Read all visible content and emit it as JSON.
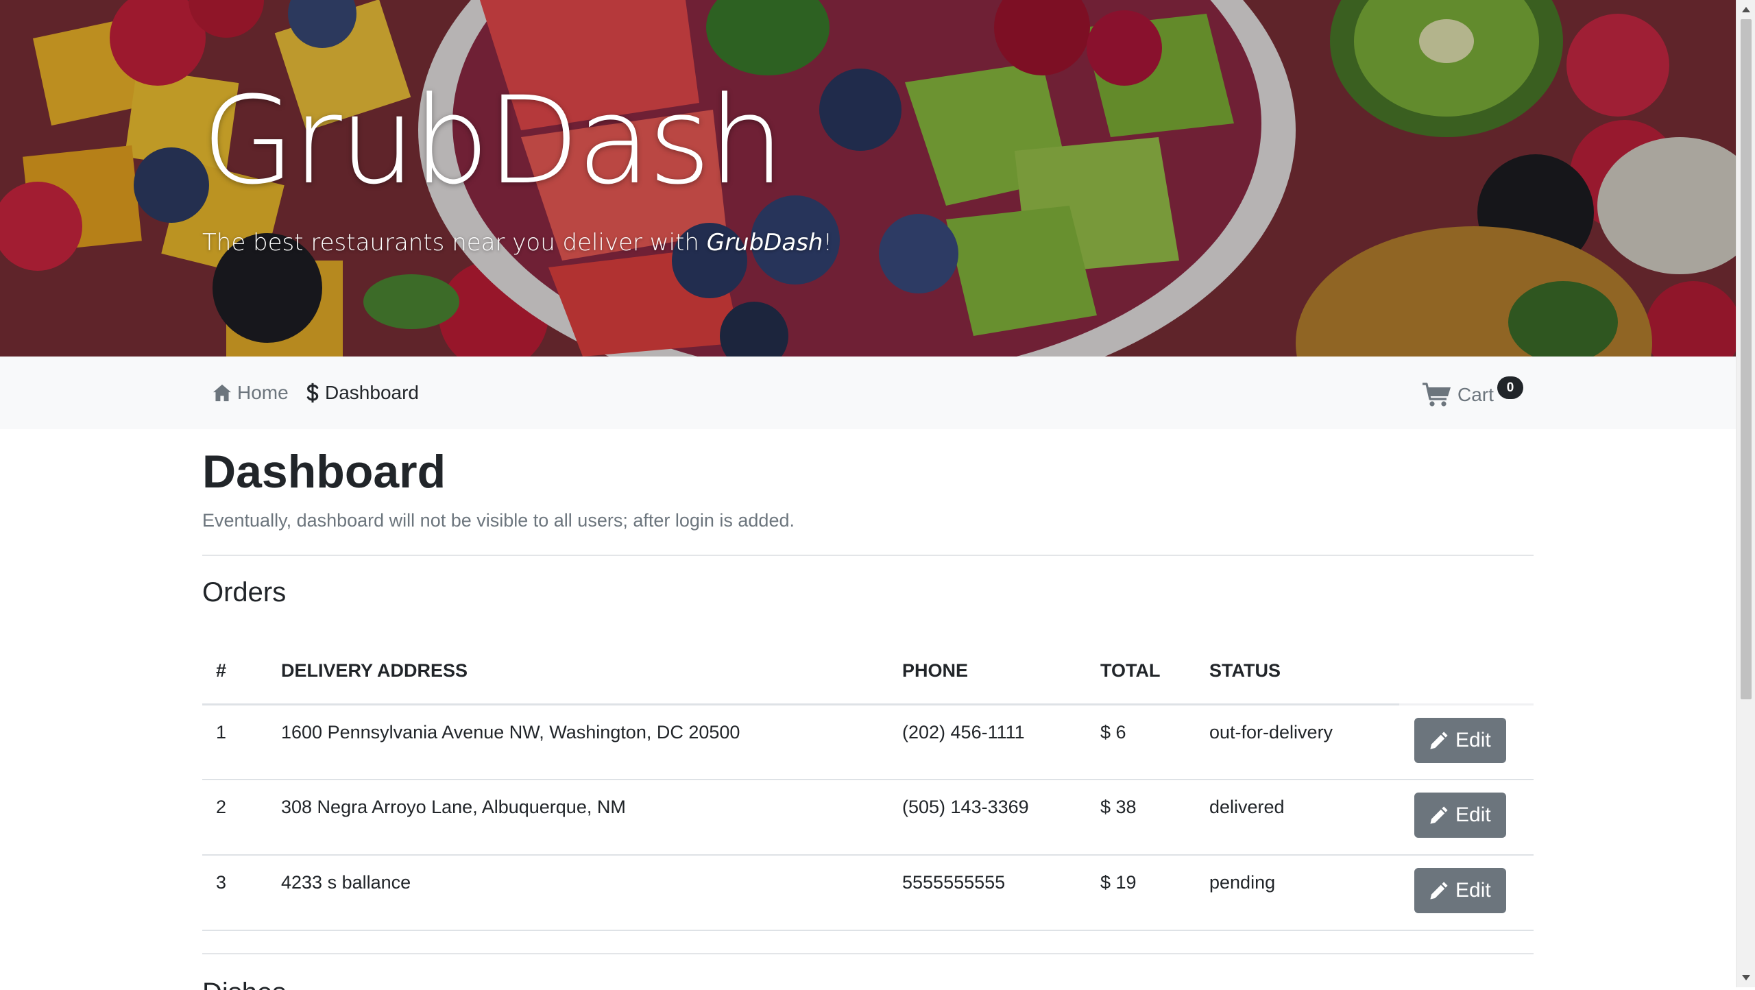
{
  "hero": {
    "brand": "GrubDash",
    "tagline_prefix": "The best restaurants near you deliver with ",
    "tagline_brand": "GrubDash",
    "tagline_suffix": "!"
  },
  "nav": {
    "home_label": "Home",
    "dashboard_label": "Dashboard",
    "cart_label": "Cart",
    "cart_count": "0"
  },
  "page": {
    "title": "Dashboard",
    "lead": "Eventually, dashboard will not be visible to all users; after login is added."
  },
  "orders": {
    "title": "Orders",
    "columns": [
      "#",
      "Delivery Address",
      "Phone",
      "Total",
      "Status"
    ],
    "rows": [
      {
        "num": "1",
        "address": "1600 Pennsylvania Avenue NW, Washington, DC 20500",
        "phone": "(202) 456-1111",
        "total": "$ 6",
        "status": "out-for-delivery",
        "action": "Edit"
      },
      {
        "num": "2",
        "address": "308 Negra Arroyo Lane, Albuquerque, NM",
        "phone": "(505) 143-3369",
        "total": "$ 38",
        "status": "delivered",
        "action": "Edit"
      },
      {
        "num": "3",
        "address": "4233 s ballance",
        "phone": "5555555555",
        "total": "$ 19",
        "status": "pending",
        "action": "Edit"
      }
    ]
  },
  "next_section": {
    "title": "Dishes"
  },
  "colors": {
    "secondary": "#6c757d",
    "dark": "#212529",
    "navbar_bg": "#f8f9fa",
    "border": "#dee2e6"
  },
  "icons": {
    "home": "house-icon",
    "dashboard": "dollar-sign-icon",
    "cart": "shopping-cart-icon",
    "edit": "pencil-icon"
  }
}
